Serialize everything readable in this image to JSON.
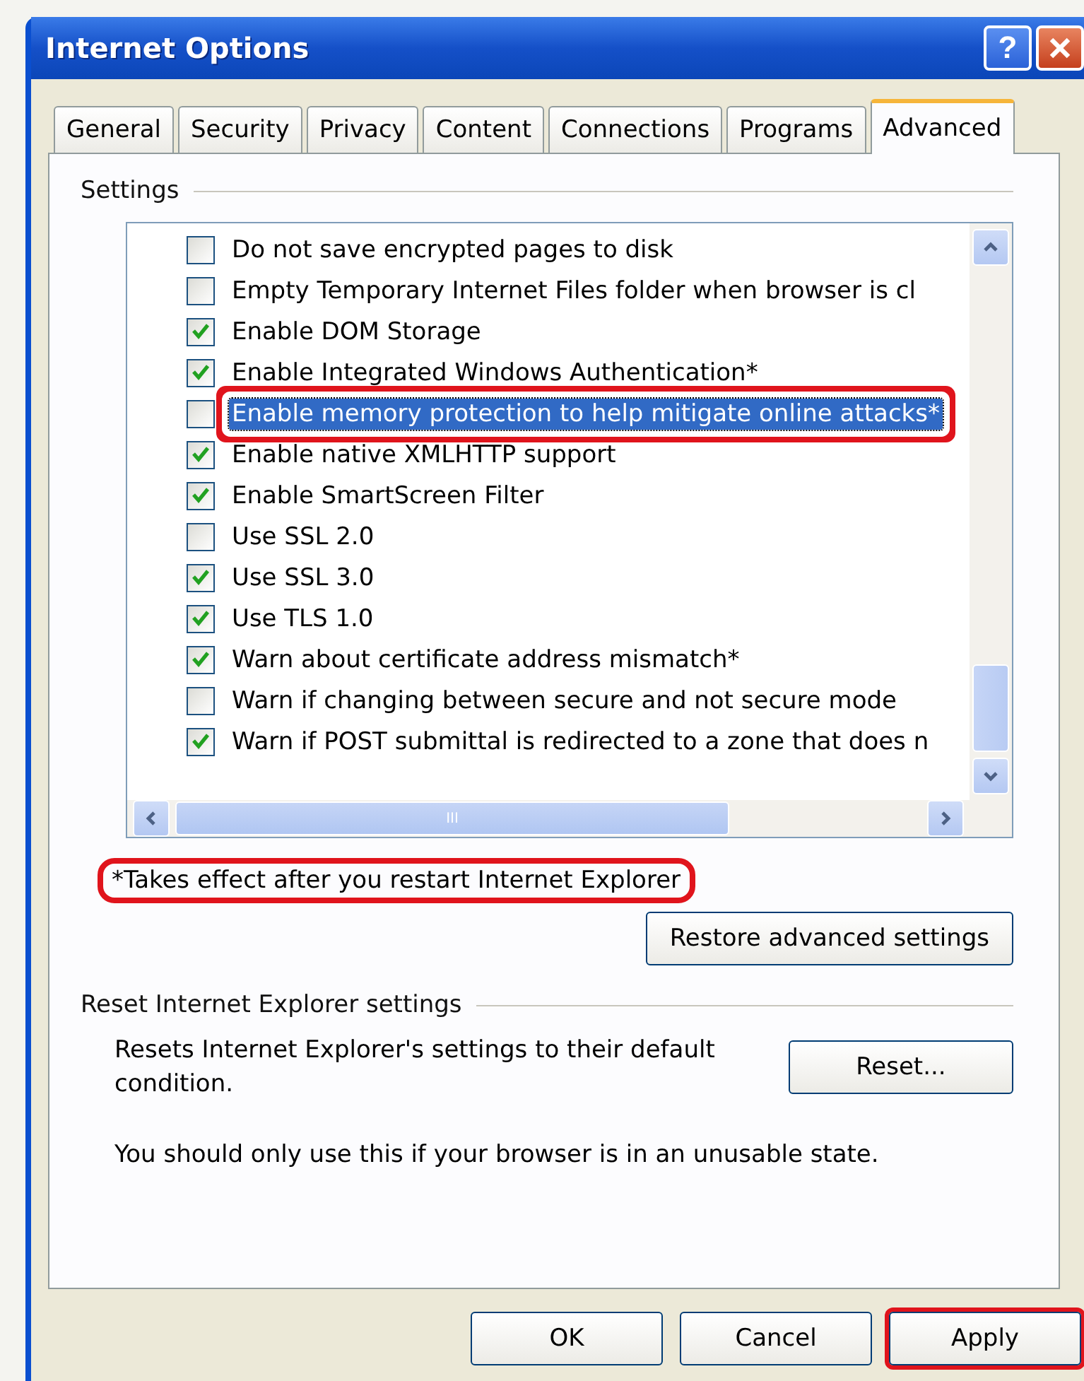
{
  "window": {
    "title": "Internet Options",
    "buttons": [
      {
        "kind": "help",
        "label": "?"
      },
      {
        "kind": "close"
      }
    ]
  },
  "tabs": [
    {
      "label": "General",
      "selected": false
    },
    {
      "label": "Security",
      "selected": false
    },
    {
      "label": "Privacy",
      "selected": false
    },
    {
      "label": "Content",
      "selected": false
    },
    {
      "label": "Connections",
      "selected": false
    },
    {
      "label": "Programs",
      "selected": false
    },
    {
      "label": "Advanced",
      "selected": true
    }
  ],
  "settings": {
    "title": "Settings",
    "items": [
      {
        "label": "Do not save encrypted pages to disk",
        "checked": false,
        "selected": false,
        "highlighted": false
      },
      {
        "label": "Empty Temporary Internet Files folder when browser is cl",
        "checked": false,
        "selected": false,
        "highlighted": false
      },
      {
        "label": "Enable DOM Storage",
        "checked": true,
        "selected": false,
        "highlighted": false
      },
      {
        "label": "Enable Integrated Windows Authentication*",
        "checked": true,
        "selected": false,
        "highlighted": false
      },
      {
        "label": "Enable memory protection to help mitigate online attacks*",
        "checked": false,
        "selected": true,
        "highlighted": true
      },
      {
        "label": "Enable native XMLHTTP support",
        "checked": true,
        "selected": false,
        "highlighted": false
      },
      {
        "label": "Enable SmartScreen Filter",
        "checked": true,
        "selected": false,
        "highlighted": false
      },
      {
        "label": "Use SSL 2.0",
        "checked": false,
        "selected": false,
        "highlighted": false
      },
      {
        "label": "Use SSL 3.0",
        "checked": true,
        "selected": false,
        "highlighted": false
      },
      {
        "label": "Use TLS 1.0",
        "checked": true,
        "selected": false,
        "highlighted": false
      },
      {
        "label": "Warn about certificate address mismatch*",
        "checked": true,
        "selected": false,
        "highlighted": false
      },
      {
        "label": "Warn if changing between secure and not secure mode",
        "checked": false,
        "selected": false,
        "highlighted": false
      },
      {
        "label": "Warn if POST submittal is redirected to a zone that does n",
        "checked": true,
        "selected": false,
        "highlighted": false
      }
    ],
    "scrollbar_grip": "III",
    "note": {
      "text": "*Takes effect after you restart Internet Explorer",
      "highlighted": true
    },
    "restore_button": "Restore advanced settings"
  },
  "reset": {
    "title": "Reset Internet Explorer settings",
    "description": "Resets Internet Explorer's settings to their default condition.",
    "button": "Reset...",
    "warning": "You should only use this if your browser is in an unusable state."
  },
  "buttons": [
    {
      "label": "OK",
      "highlighted": false
    },
    {
      "label": "Cancel",
      "highlighted": false
    },
    {
      "label": "Apply",
      "highlighted": true
    }
  ]
}
